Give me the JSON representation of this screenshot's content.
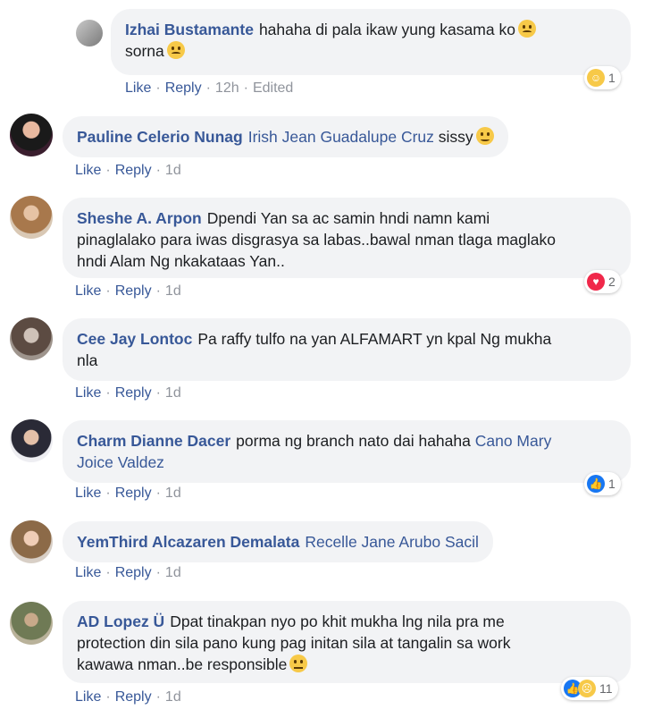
{
  "comments": [
    {
      "author": "Izhai Bustamante",
      "text": "hahaha di pala ikaw yung kasama ko",
      "text2": "sorna",
      "actions": {
        "like": "Like",
        "reply": "Reply",
        "time": "12h",
        "edited": "Edited"
      },
      "reactions": {
        "count": "1",
        "types": [
          "haha"
        ]
      }
    },
    {
      "author": "Pauline Celerio Nunag",
      "tag": "Irish Jean Guadalupe Cruz",
      "text": "sissy",
      "actions": {
        "like": "Like",
        "reply": "Reply",
        "time": "1d"
      }
    },
    {
      "author": "Sheshe A. Arpon",
      "text": "Dpendi Yan sa ac samin hndi namn kami",
      "text2": "pinaglalako para iwas disgrasya sa labas..bawal nman tlaga maglako",
      "text3": "hndi Alam Ng nkakataas Yan..",
      "actions": {
        "like": "Like",
        "reply": "Reply",
        "time": "1d"
      },
      "reactions": {
        "count": "2",
        "types": [
          "love"
        ]
      }
    },
    {
      "author": "Cee Jay Lontoc",
      "text": "Pa raffy tulfo na yan ALFAMART yn kpal Ng mukha",
      "text2": "nla",
      "actions": {
        "like": "Like",
        "reply": "Reply",
        "time": "1d"
      }
    },
    {
      "author": "Charm Dianne Dacer",
      "text": "porma ng branch nato dai hahaha",
      "tag": "Cano Mary",
      "tag2": "Joice Valdez",
      "actions": {
        "like": "Like",
        "reply": "Reply",
        "time": "1d"
      },
      "reactions": {
        "count": "1",
        "types": [
          "like"
        ]
      }
    },
    {
      "author": "YemThird Alcazaren Demalata",
      "tag": "Recelle Jane Arubo Sacil",
      "actions": {
        "like": "Like",
        "reply": "Reply",
        "time": "1d"
      }
    },
    {
      "author": "AD Lopez Ü",
      "text": "Dpat tinakpan nyo po khit mukha lng nila pra me",
      "text2": "protection din sila pano kung pag initan sila at tangalin sa work",
      "text3": "kawawa nman..be responsible",
      "actions": {
        "like": "Like",
        "reply": "Reply",
        "time": "1d"
      },
      "reactions": {
        "count": "11",
        "types": [
          "like",
          "sad"
        ]
      }
    }
  ],
  "colors": {
    "link": "#385898",
    "meta": "#90949c",
    "bubble": "#f2f3f5"
  }
}
